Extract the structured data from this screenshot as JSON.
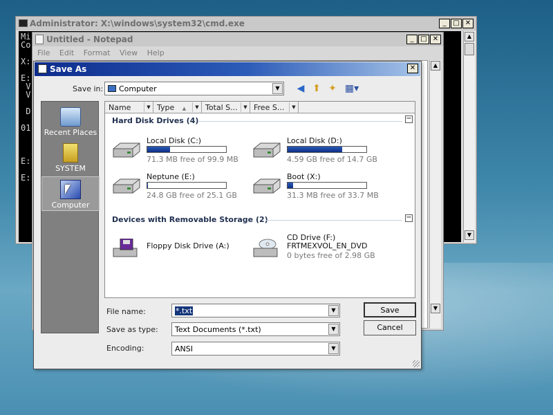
{
  "cmd": {
    "title": "Administrator: X:\\windows\\system32\\cmd.exe",
    "console_lines": [
      "Mi",
      "Co",
      "",
      "X:",
      "",
      "E:",
      " V",
      " V",
      "",
      " D",
      "",
      "01",
      "",
      "",
      "",
      "E:",
      "",
      "E:"
    ]
  },
  "notepad": {
    "title": "Untitled - Notepad",
    "menu": [
      "File",
      "Edit",
      "Format",
      "View",
      "Help"
    ]
  },
  "dialog": {
    "title": "Save As",
    "save_in_label": "Save in:",
    "save_in_value": "Computer",
    "places": [
      {
        "label": "Recent Places",
        "icon": "recent-places-icon"
      },
      {
        "label": "SYSTEM",
        "icon": "folder-icon"
      },
      {
        "label": "Computer",
        "icon": "computer-icon",
        "selected": true
      }
    ],
    "columns": [
      "Name",
      "Type",
      "Total S...",
      "Free S..."
    ],
    "groups": [
      {
        "title": "Hard Disk Drives (4)",
        "drives": [
          {
            "name": "Local Disk (C:)",
            "free": "71.3 MB free of 99.9 MB",
            "used_fraction": 0.29
          },
          {
            "name": "Local Disk (D:)",
            "free": "4.59 GB free of 14.7 GB",
            "used_fraction": 0.69
          },
          {
            "name": "Neptune (E:)",
            "free": "24.8 GB free of 25.1 GB",
            "used_fraction": 0.01
          },
          {
            "name": "Boot (X:)",
            "free": "31.3 MB free of 33.7 MB",
            "used_fraction": 0.07
          }
        ]
      },
      {
        "title": "Devices with Removable Storage (2)",
        "drives": [
          {
            "name": "Floppy Disk Drive (A:)"
          },
          {
            "name": "CD Drive (F:)",
            "subname": "FRTMEXVOL_EN_DVD",
            "free": "0 bytes free of 2.98 GB"
          }
        ]
      }
    ],
    "file_name_label": "File name:",
    "file_name_value": "*.txt",
    "save_type_label": "Save as type:",
    "save_type_value": "Text Documents (*.txt)",
    "encoding_label": "Encoding:",
    "encoding_value": "ANSI",
    "save_button": "Save",
    "cancel_button": "Cancel",
    "colors": {
      "title_start": "#0d2c8c",
      "bar_fill": "#1a40a0"
    }
  }
}
